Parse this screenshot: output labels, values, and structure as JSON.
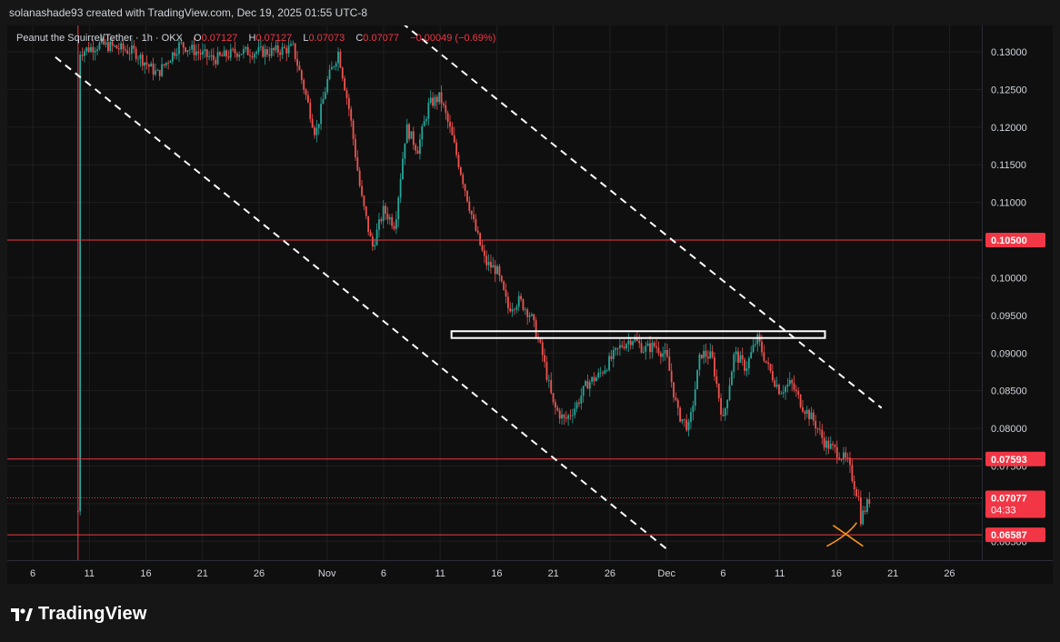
{
  "header": {
    "author_line": "solanashade93 created with TradingView.com, Dec 19, 2025 01:55 UTC-8"
  },
  "legend": {
    "symbol": "Peanut the Squirrel/Tether",
    "interval": "1h",
    "exchange": "OKX",
    "o_label": "O",
    "o_value": "0.07127",
    "h_label": "H",
    "h_value": "0.07127",
    "l_label": "L",
    "l_value": "0.07073",
    "c_label": "C",
    "c_value": "0.07077",
    "change": "−0.00049 (−0.69%)"
  },
  "colors": {
    "background": "#0f0f0f",
    "up": "#26a69a",
    "down": "#ef5350",
    "level": "#f23645",
    "channel": "#ffffff",
    "marker": "#f7931a"
  },
  "logo": {
    "text": "TradingView"
  },
  "chart_data": {
    "type": "candlestick",
    "instrument": "Peanut the Squirrel/Tether",
    "interval": "1h",
    "y_axis": {
      "ticks": [
        "0.13000",
        "0.12500",
        "0.12000",
        "0.11500",
        "0.11000",
        "0.10500",
        "0.10000",
        "0.09500",
        "0.09000",
        "0.08500",
        "0.08000",
        "0.07500",
        "0.07000",
        "0.06500"
      ],
      "ylim": [
        0.0625,
        0.1335
      ]
    },
    "x_axis": {
      "ticks": [
        "6",
        "11",
        "16",
        "21",
        "26",
        "Nov",
        "6",
        "11",
        "16",
        "21",
        "26",
        "Dec",
        "6",
        "11",
        "16",
        "21",
        "26"
      ],
      "tick_dates": [
        "2025-10-06",
        "2025-10-11",
        "2025-10-16",
        "2025-10-21",
        "2025-10-26",
        "2025-11-01",
        "2025-11-06",
        "2025-11-11",
        "2025-11-16",
        "2025-11-21",
        "2025-11-26",
        "2025-12-01",
        "2025-12-06",
        "2025-12-11",
        "2025-12-16",
        "2025-12-21",
        "2025-12-26"
      ]
    },
    "price_path": [
      [
        "2025-10-10",
        0.069
      ],
      [
        "2025-10-10",
        0.13
      ],
      [
        "2025-10-12",
        0.131
      ],
      [
        "2025-10-15",
        0.13
      ],
      [
        "2025-10-17",
        0.127
      ],
      [
        "2025-10-19",
        0.131
      ],
      [
        "2025-10-22",
        0.129
      ],
      [
        "2025-10-24",
        0.13
      ],
      [
        "2025-10-27",
        0.13
      ],
      [
        "2025-10-29",
        0.1305
      ],
      [
        "2025-10-30",
        0.125
      ],
      [
        "2025-10-31",
        0.119
      ],
      [
        "2025-11-01",
        0.126
      ],
      [
        "2025-11-02",
        0.13
      ],
      [
        "2025-11-03",
        0.122
      ],
      [
        "2025-11-04",
        0.111
      ],
      [
        "2025-11-05",
        0.104
      ],
      [
        "2025-11-06",
        0.109
      ],
      [
        "2025-11-07",
        0.107
      ],
      [
        "2025-11-08",
        0.12
      ],
      [
        "2025-11-09",
        0.117
      ],
      [
        "2025-11-10",
        0.123
      ],
      [
        "2025-11-11",
        0.124
      ],
      [
        "2025-11-12",
        0.119
      ],
      [
        "2025-11-13",
        0.113
      ],
      [
        "2025-11-14",
        0.107
      ],
      [
        "2025-11-15",
        0.102
      ],
      [
        "2025-11-16",
        0.101
      ],
      [
        "2025-11-17",
        0.096
      ],
      [
        "2025-11-18",
        0.097
      ],
      [
        "2025-11-19",
        0.095
      ],
      [
        "2025-11-20",
        0.09
      ],
      [
        "2025-11-21",
        0.083
      ],
      [
        "2025-11-22",
        0.081
      ],
      [
        "2025-11-23",
        0.083
      ],
      [
        "2025-11-24",
        0.086
      ],
      [
        "2025-11-25",
        0.087
      ],
      [
        "2025-11-26",
        0.089
      ],
      [
        "2025-11-27",
        0.091
      ],
      [
        "2025-11-28",
        0.092
      ],
      [
        "2025-11-29",
        0.0905
      ],
      [
        "2025-11-30",
        0.091
      ],
      [
        "2025-12-01",
        0.0895
      ],
      [
        "2025-12-02",
        0.082
      ],
      [
        "2025-12-03",
        0.08
      ],
      [
        "2025-12-04",
        0.09
      ],
      [
        "2025-12-05",
        0.0895
      ],
      [
        "2025-12-06",
        0.081
      ],
      [
        "2025-12-07",
        0.09
      ],
      [
        "2025-12-08",
        0.088
      ],
      [
        "2025-12-09",
        0.092
      ],
      [
        "2025-12-10",
        0.088
      ],
      [
        "2025-12-11",
        0.085
      ],
      [
        "2025-12-12",
        0.086
      ],
      [
        "2025-12-13",
        0.083
      ],
      [
        "2025-12-14",
        0.081
      ],
      [
        "2025-12-15",
        0.078
      ],
      [
        "2025-12-16",
        0.077
      ],
      [
        "2025-12-17",
        0.0755
      ],
      [
        "2025-12-18",
        0.0705
      ],
      [
        "2025-12-18",
        0.068
      ],
      [
        "2025-12-19",
        0.0708
      ]
    ],
    "horizontal_levels": [
      {
        "value": 0.105,
        "label": "0.10500"
      },
      {
        "value": 0.07593,
        "label": "0.07593"
      },
      {
        "value": 0.06587,
        "label": "0.06587"
      }
    ],
    "vertical_line_date": "2025-10-10",
    "last_price": {
      "value": 0.07077,
      "label": "0.07077",
      "countdown": "04:33"
    },
    "resistance_zone": {
      "x0": "2025-11-12",
      "x1": "2025-12-15",
      "y0": 0.092,
      "y1": 0.0929
    },
    "channel_lines": [
      {
        "from": [
          "2025-10-08",
          0.1293
        ],
        "to": [
          "2025-12-01",
          0.064
        ]
      },
      {
        "from": [
          "2025-11-05",
          0.137
        ],
        "to": [
          "2025-12-20",
          0.0827
        ]
      }
    ],
    "marker": {
      "date": "2025-12-17",
      "value": 0.0658,
      "shape": "cross"
    },
    "grid": true
  }
}
